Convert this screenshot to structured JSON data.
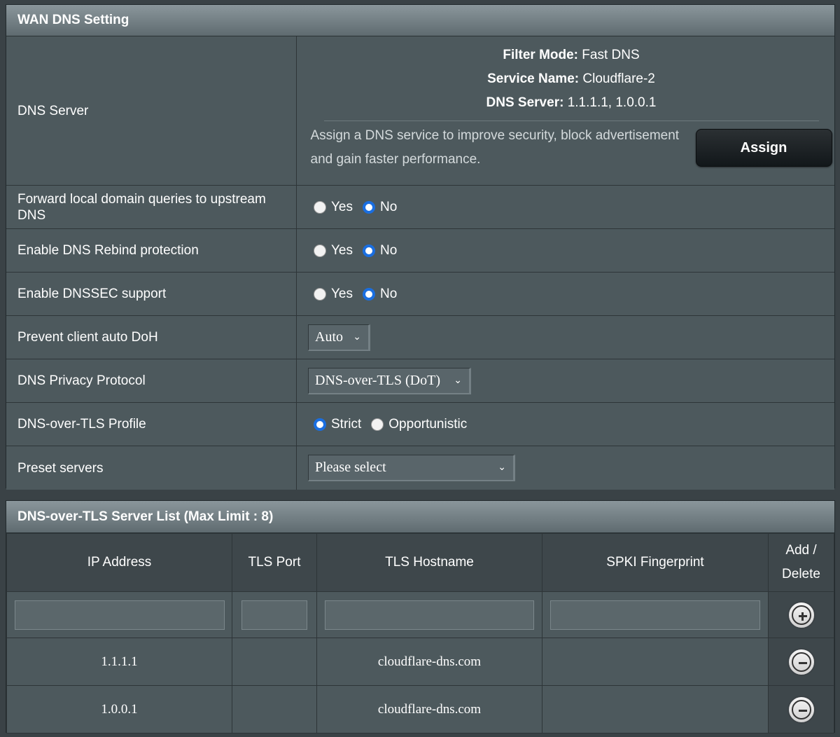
{
  "wan_dns": {
    "title": "WAN DNS Setting",
    "dns_server": {
      "label": "DNS Server",
      "filter_mode_key": "Filter Mode:",
      "filter_mode_value": " Fast DNS",
      "service_name_key": "Service Name:",
      "service_name_value": " Cloudflare-2",
      "dns_server_key": "DNS Server:",
      "dns_server_value": " 1.1.1.1, 1.0.0.1",
      "description": "Assign a DNS service to improve security, block advertisement and gain faster performance.",
      "assign_label": "Assign"
    },
    "forward_local": {
      "label": "Forward local domain queries to upstream DNS",
      "yes": "Yes",
      "no": "No",
      "selected": "No"
    },
    "rebind": {
      "label": "Enable DNS Rebind protection",
      "yes": "Yes",
      "no": "No",
      "selected": "No"
    },
    "dnssec": {
      "label": "Enable DNSSEC support",
      "yes": "Yes",
      "no": "No",
      "selected": "No"
    },
    "auto_doh": {
      "label": "Prevent client auto DoH",
      "value": "Auto"
    },
    "privacy_protocol": {
      "label": "DNS Privacy Protocol",
      "value": "DNS-over-TLS (DoT)"
    },
    "tls_profile": {
      "label": "DNS-over-TLS Profile",
      "strict": "Strict",
      "opportunistic": "Opportunistic",
      "selected": "Strict"
    },
    "preset_servers": {
      "label": "Preset servers",
      "value": "Please select"
    }
  },
  "server_list": {
    "title": "DNS-over-TLS Server List (Max Limit : 8)",
    "columns": {
      "ip": "IP Address",
      "port": "TLS Port",
      "hostname": "TLS Hostname",
      "spki": "SPKI Fingerprint",
      "add_delete_line1": "Add /",
      "add_delete_line2": "Delete"
    },
    "rows": [
      {
        "ip": "1.1.1.1",
        "port": "",
        "hostname": "cloudflare-dns.com",
        "spki": ""
      },
      {
        "ip": "1.0.0.1",
        "port": "",
        "hostname": "cloudflare-dns.com",
        "spki": ""
      }
    ]
  },
  "icons": {
    "add": "plus-circle-icon",
    "delete": "minus-circle-icon",
    "dropdown": "chevron-down-icon"
  },
  "colors": {
    "radio_selected": "#1a6ee0",
    "panel_bg": "#4d595d",
    "header_gradient_top": "#8a969b"
  }
}
